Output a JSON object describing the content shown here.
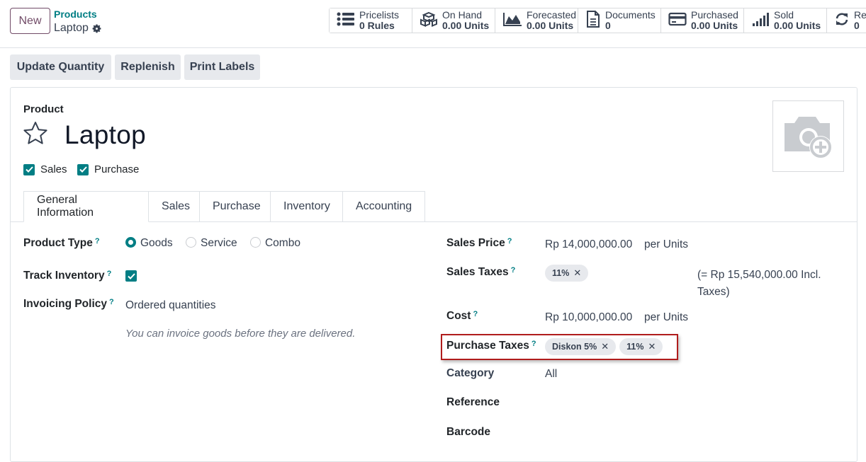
{
  "control_panel": {
    "new_label": "New",
    "breadcrumb_root": "Products",
    "breadcrumb_current": "Laptop",
    "stats": [
      {
        "icon": "list-icon",
        "label": "Pricelists",
        "value": "0 Rules"
      },
      {
        "icon": "cubes-icon",
        "label": "On Hand",
        "value": "0.00 Units"
      },
      {
        "icon": "area-chart-icon",
        "label": "Forecasted",
        "value": "0.00 Units"
      },
      {
        "icon": "document-icon",
        "label": "Documents",
        "value": "0"
      },
      {
        "icon": "credit-card-icon",
        "label": "Purchased",
        "value": "0.00 Units"
      },
      {
        "icon": "bar-chart-icon",
        "label": "Sold",
        "value": "0.00 Units"
      },
      {
        "icon": "refresh-icon",
        "label": "Re",
        "value": "0"
      }
    ]
  },
  "actions": {
    "update_quantity": "Update Quantity",
    "replenish": "Replenish",
    "print_labels": "Print Labels"
  },
  "product": {
    "section_label": "Product",
    "name": "Laptop",
    "sales_label": "Sales",
    "purchase_label": "Purchase",
    "sales_checked": true,
    "purchase_checked": true
  },
  "tabs": [
    "General Information",
    "Sales",
    "Purchase",
    "Inventory",
    "Accounting"
  ],
  "help_mark": "?",
  "left_fields": {
    "product_type_label": "Product Type",
    "type_options": [
      "Goods",
      "Service",
      "Combo"
    ],
    "type_selected": "Goods",
    "track_inventory_label": "Track Inventory",
    "track_inventory_checked": true,
    "invoicing_policy_label": "Invoicing Policy",
    "invoicing_policy_value": "Ordered quantities",
    "invoicing_hint": "You can invoice goods before they are delivered."
  },
  "right_fields": {
    "sales_price_label": "Sales Price",
    "sales_price_value": "Rp 14,000,000.00",
    "sales_price_unit": "per Units",
    "sales_taxes_label": "Sales Taxes",
    "sales_taxes_tags": [
      "11%"
    ],
    "incl_taxes_line1": "(= Rp 15,540,000.00 Incl.",
    "incl_taxes_line2": "Taxes)",
    "cost_label": "Cost",
    "cost_value": "Rp 10,000,000.00",
    "cost_unit": "per Units",
    "purchase_taxes_label": "Purchase Taxes",
    "purchase_taxes_tags": [
      "Diskon 5%",
      "11%"
    ],
    "category_label": "Category",
    "category_value": "All",
    "reference_label": "Reference",
    "barcode_label": "Barcode"
  },
  "colors": {
    "accent": "#017e84",
    "brand": "#714b67",
    "highlight": "#b01c1c"
  }
}
